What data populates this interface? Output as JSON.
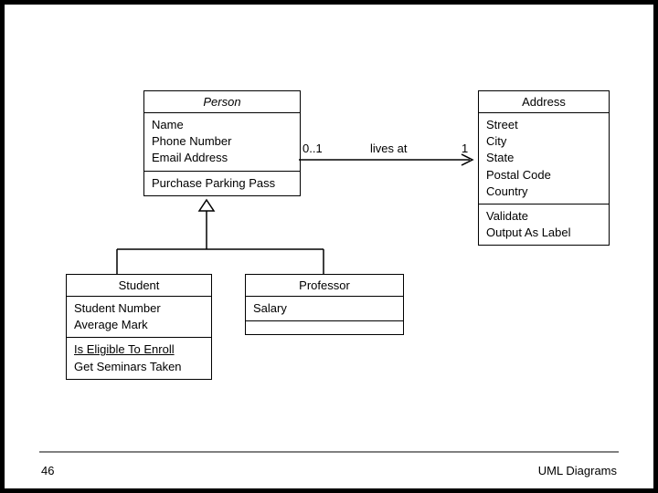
{
  "classes": {
    "person": {
      "name": "Person",
      "attributes": [
        "Name",
        "Phone Number",
        "Email Address"
      ],
      "operations": [
        "Purchase Parking Pass"
      ]
    },
    "address": {
      "name": "Address",
      "attributes": [
        "Street",
        "City",
        "State",
        "Postal Code",
        "Country"
      ],
      "operations": [
        "Validate",
        "Output As Label"
      ]
    },
    "student": {
      "name": "Student",
      "attributes": [
        "Student Number",
        "Average Mark"
      ],
      "operations": [
        "Is Eligible To Enroll",
        "Get Seminars Taken"
      ]
    },
    "professor": {
      "name": "Professor",
      "attributes": [
        "Salary"
      ]
    }
  },
  "association": {
    "left_mult": "0..1",
    "label": "lives at",
    "right_mult": "1"
  },
  "footer": {
    "page": "46",
    "caption": "UML Diagrams"
  }
}
